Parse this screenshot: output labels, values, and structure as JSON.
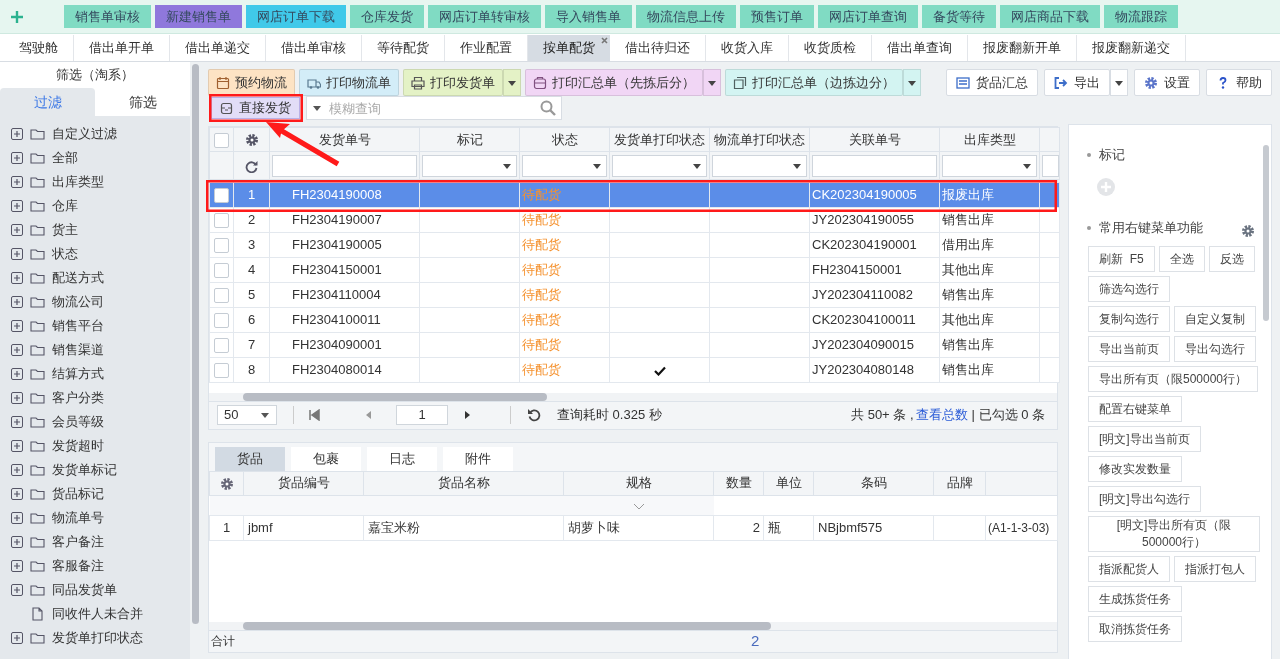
{
  "top_nav": [
    {
      "label": "销售单审核",
      "color": "#80dbc3"
    },
    {
      "label": "新建销售单",
      "color": "#8f78dc"
    },
    {
      "label": "网店订单下载",
      "color": "#40c9e9"
    },
    {
      "label": "仓库发货",
      "color": "#80dbc3"
    },
    {
      "label": "网店订单转审核",
      "color": "#80dbc3"
    },
    {
      "label": "导入销售单",
      "color": "#80dbc3"
    },
    {
      "label": "物流信息上传",
      "color": "#80dbc3"
    },
    {
      "label": "预售订单",
      "color": "#80dbc3"
    },
    {
      "label": "网店订单查询",
      "color": "#80dbc3"
    },
    {
      "label": "备货等待",
      "color": "#80dbc3"
    },
    {
      "label": "网店商品下载",
      "color": "#80dbc3"
    },
    {
      "label": "物流跟踪",
      "color": "#80dbc3"
    }
  ],
  "tabs": [
    {
      "label": "驾驶舱",
      "selected": false
    },
    {
      "label": "借出单开单",
      "selected": false
    },
    {
      "label": "借出单递交",
      "selected": false
    },
    {
      "label": "借出单审核",
      "selected": false
    },
    {
      "label": "等待配货",
      "selected": false
    },
    {
      "label": "作业配置",
      "selected": false
    },
    {
      "label": "按单配货",
      "selected": true
    },
    {
      "label": "借出待归还",
      "selected": false
    },
    {
      "label": "收货入库",
      "selected": false
    },
    {
      "label": "收货质检",
      "selected": false
    },
    {
      "label": "借出单查询",
      "selected": false
    },
    {
      "label": "报废翻新开单",
      "selected": false
    },
    {
      "label": "报废翻新递交",
      "selected": false
    }
  ],
  "sidebar": {
    "title": "筛选（淘系）",
    "tabs": [
      {
        "label": "过滤",
        "selected": true
      },
      {
        "label": "筛选",
        "selected": false
      }
    ],
    "items": [
      {
        "label": "自定义过滤",
        "kind": "folder"
      },
      {
        "label": "全部",
        "kind": "folder"
      },
      {
        "label": "出库类型",
        "kind": "folder"
      },
      {
        "label": "仓库",
        "kind": "folder"
      },
      {
        "label": "货主",
        "kind": "folder"
      },
      {
        "label": "状态",
        "kind": "folder"
      },
      {
        "label": "配送方式",
        "kind": "folder"
      },
      {
        "label": "物流公司",
        "kind": "folder"
      },
      {
        "label": "销售平台",
        "kind": "folder"
      },
      {
        "label": "销售渠道",
        "kind": "folder"
      },
      {
        "label": "结算方式",
        "kind": "folder"
      },
      {
        "label": "客户分类",
        "kind": "folder"
      },
      {
        "label": "会员等级",
        "kind": "folder"
      },
      {
        "label": "发货超时",
        "kind": "folder"
      },
      {
        "label": "发货单标记",
        "kind": "folder"
      },
      {
        "label": "货品标记",
        "kind": "folder"
      },
      {
        "label": "物流单号",
        "kind": "folder"
      },
      {
        "label": "客户备注",
        "kind": "folder"
      },
      {
        "label": "客服备注",
        "kind": "folder"
      },
      {
        "label": "同品发货单",
        "kind": "folder"
      },
      {
        "label": "同收件人未合并",
        "kind": "file"
      },
      {
        "label": "发货单打印状态",
        "kind": "folder"
      }
    ]
  },
  "toolbar": {
    "buttons": [
      {
        "label": "预约物流",
        "color": "#fde3c4",
        "dropdown": false
      },
      {
        "label": "打印物流单",
        "color": "#d3edf8",
        "dropdown": false
      },
      {
        "label": "打印发货单",
        "color": "#e4f2c6",
        "dropdown": true
      },
      {
        "label": "打印汇总单（先拣后分）",
        "color": "#f1d6f5",
        "dropdown": true
      },
      {
        "label": "打印汇总单（边拣边分）",
        "color": "#d3f4f2",
        "dropdown": true
      }
    ],
    "direct_ship": {
      "label": "直接发货",
      "color": "#e2ddf7"
    },
    "search": {
      "placeholder": "模糊查询"
    },
    "right_buttons": [
      {
        "label": "货品汇总",
        "dropdown": false
      },
      {
        "label": "导出",
        "dropdown": true
      },
      {
        "label": "设置",
        "dropdown": false
      },
      {
        "label": "帮助",
        "dropdown": false
      }
    ]
  },
  "orders": {
    "select_all_checked": false,
    "columns": [
      {
        "label": "发货单号",
        "kind": "textbox"
      },
      {
        "label": "标记",
        "kind": "dropdown"
      },
      {
        "label": "状态",
        "kind": "dropdown"
      },
      {
        "label": "发货单打印状态",
        "kind": "dropdown"
      },
      {
        "label": "物流单打印状态",
        "kind": "dropdown"
      },
      {
        "label": "关联单号",
        "kind": "textbox"
      },
      {
        "label": "出库类型",
        "kind": "dropdown"
      }
    ],
    "rows": [
      {
        "no": "1",
        "order_no": "FH2304190008",
        "status": "待配货",
        "invoice_printed": false,
        "related_no": "CK202304190005",
        "out_type": "报废出库",
        "checked": false,
        "selected": true
      },
      {
        "no": "2",
        "order_no": "FH2304190007",
        "status": "待配货",
        "invoice_printed": false,
        "related_no": "JY202304190055",
        "out_type": "销售出库",
        "checked": false,
        "selected": false
      },
      {
        "no": "3",
        "order_no": "FH2304190005",
        "status": "待配货",
        "invoice_printed": false,
        "related_no": "CK202304190001",
        "out_type": "借用出库",
        "checked": false,
        "selected": false
      },
      {
        "no": "4",
        "order_no": "FH2304150001",
        "status": "待配货",
        "invoice_printed": false,
        "related_no": "FH2304150001",
        "out_type": "其他出库",
        "checked": false,
        "selected": false
      },
      {
        "no": "5",
        "order_no": "FH2304110004",
        "status": "待配货",
        "invoice_printed": false,
        "related_no": "JY202304110082",
        "out_type": "销售出库",
        "checked": false,
        "selected": false
      },
      {
        "no": "6",
        "order_no": "FH2304100011",
        "status": "待配货",
        "invoice_printed": false,
        "related_no": "CK202304100011",
        "out_type": "其他出库",
        "checked": false,
        "selected": false
      },
      {
        "no": "7",
        "order_no": "FH2304090001",
        "status": "待配货",
        "invoice_printed": false,
        "related_no": "JY202304090015",
        "out_type": "销售出库",
        "checked": false,
        "selected": false
      },
      {
        "no": "8",
        "order_no": "FH2304080014",
        "status": "待配货",
        "invoice_printed": true,
        "related_no": "JY202304080148",
        "out_type": "销售出库",
        "checked": false,
        "selected": false
      }
    ]
  },
  "pager": {
    "page_size": "50",
    "page": "1",
    "query_time": "查询耗时 0.325 秒",
    "total": "共 50+ 条 ,",
    "total_link": "查看总数",
    "checked_count": "| 已勾选 0 条"
  },
  "detail": {
    "tabs": [
      {
        "label": "货品",
        "selected": true
      },
      {
        "label": "包裹",
        "selected": false
      },
      {
        "label": "日志",
        "selected": false
      },
      {
        "label": "附件",
        "selected": false
      }
    ],
    "columns": [
      "货品编号",
      "货品名称",
      "规格",
      "数量",
      "单位",
      "条码",
      "品牌"
    ],
    "rows": [
      {
        "no": "1",
        "code": "jbmf",
        "name": "嘉宝米粉",
        "spec": "胡萝卜味",
        "qty": "2",
        "unit": "瓶",
        "barcode": "NBjbmf575",
        "column_9": "(A1-1-3-03)"
      }
    ],
    "footer_label": "合计",
    "footer_qty": "2"
  },
  "side_panel": {
    "tag_title": "标记",
    "menu_title": "常用右键菜单功能",
    "menu_rows": [
      [
        "刷新  F5",
        "全选",
        "反选"
      ],
      [
        "筛选勾选行"
      ],
      [
        "复制勾选行",
        "自定义复制"
      ],
      [
        "导出当前页",
        "导出勾选行"
      ],
      [
        "导出所有页（限500000行）"
      ],
      [
        "配置右键菜单"
      ],
      [
        "[明文]导出当前页"
      ],
      [
        "修改实发数量"
      ],
      [
        "[明文]导出勾选行"
      ],
      [
        "[明文]导出所有页（限500000行）"
      ],
      [
        "指派配货人",
        "指派打包人"
      ],
      [
        "生成拣货任务"
      ],
      [
        "取消拣货任务"
      ]
    ]
  }
}
